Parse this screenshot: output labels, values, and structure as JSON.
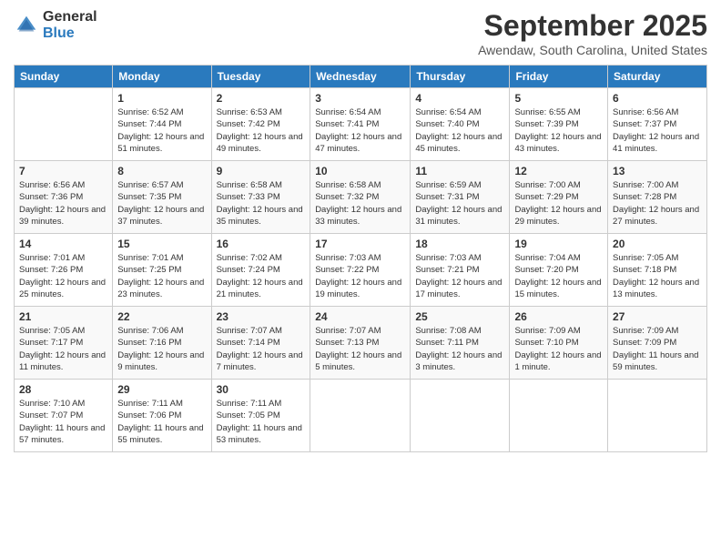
{
  "logo": {
    "line1": "General",
    "line2": "Blue"
  },
  "title": "September 2025",
  "subtitle": "Awendaw, South Carolina, United States",
  "header_days": [
    "Sunday",
    "Monday",
    "Tuesday",
    "Wednesday",
    "Thursday",
    "Friday",
    "Saturday"
  ],
  "weeks": [
    [
      {
        "day": "",
        "sunrise": "",
        "sunset": "",
        "daylight": ""
      },
      {
        "day": "1",
        "sunrise": "Sunrise: 6:52 AM",
        "sunset": "Sunset: 7:44 PM",
        "daylight": "Daylight: 12 hours and 51 minutes."
      },
      {
        "day": "2",
        "sunrise": "Sunrise: 6:53 AM",
        "sunset": "Sunset: 7:42 PM",
        "daylight": "Daylight: 12 hours and 49 minutes."
      },
      {
        "day": "3",
        "sunrise": "Sunrise: 6:54 AM",
        "sunset": "Sunset: 7:41 PM",
        "daylight": "Daylight: 12 hours and 47 minutes."
      },
      {
        "day": "4",
        "sunrise": "Sunrise: 6:54 AM",
        "sunset": "Sunset: 7:40 PM",
        "daylight": "Daylight: 12 hours and 45 minutes."
      },
      {
        "day": "5",
        "sunrise": "Sunrise: 6:55 AM",
        "sunset": "Sunset: 7:39 PM",
        "daylight": "Daylight: 12 hours and 43 minutes."
      },
      {
        "day": "6",
        "sunrise": "Sunrise: 6:56 AM",
        "sunset": "Sunset: 7:37 PM",
        "daylight": "Daylight: 12 hours and 41 minutes."
      }
    ],
    [
      {
        "day": "7",
        "sunrise": "Sunrise: 6:56 AM",
        "sunset": "Sunset: 7:36 PM",
        "daylight": "Daylight: 12 hours and 39 minutes."
      },
      {
        "day": "8",
        "sunrise": "Sunrise: 6:57 AM",
        "sunset": "Sunset: 7:35 PM",
        "daylight": "Daylight: 12 hours and 37 minutes."
      },
      {
        "day": "9",
        "sunrise": "Sunrise: 6:58 AM",
        "sunset": "Sunset: 7:33 PM",
        "daylight": "Daylight: 12 hours and 35 minutes."
      },
      {
        "day": "10",
        "sunrise": "Sunrise: 6:58 AM",
        "sunset": "Sunset: 7:32 PM",
        "daylight": "Daylight: 12 hours and 33 minutes."
      },
      {
        "day": "11",
        "sunrise": "Sunrise: 6:59 AM",
        "sunset": "Sunset: 7:31 PM",
        "daylight": "Daylight: 12 hours and 31 minutes."
      },
      {
        "day": "12",
        "sunrise": "Sunrise: 7:00 AM",
        "sunset": "Sunset: 7:29 PM",
        "daylight": "Daylight: 12 hours and 29 minutes."
      },
      {
        "day": "13",
        "sunrise": "Sunrise: 7:00 AM",
        "sunset": "Sunset: 7:28 PM",
        "daylight": "Daylight: 12 hours and 27 minutes."
      }
    ],
    [
      {
        "day": "14",
        "sunrise": "Sunrise: 7:01 AM",
        "sunset": "Sunset: 7:26 PM",
        "daylight": "Daylight: 12 hours and 25 minutes."
      },
      {
        "day": "15",
        "sunrise": "Sunrise: 7:01 AM",
        "sunset": "Sunset: 7:25 PM",
        "daylight": "Daylight: 12 hours and 23 minutes."
      },
      {
        "day": "16",
        "sunrise": "Sunrise: 7:02 AM",
        "sunset": "Sunset: 7:24 PM",
        "daylight": "Daylight: 12 hours and 21 minutes."
      },
      {
        "day": "17",
        "sunrise": "Sunrise: 7:03 AM",
        "sunset": "Sunset: 7:22 PM",
        "daylight": "Daylight: 12 hours and 19 minutes."
      },
      {
        "day": "18",
        "sunrise": "Sunrise: 7:03 AM",
        "sunset": "Sunset: 7:21 PM",
        "daylight": "Daylight: 12 hours and 17 minutes."
      },
      {
        "day": "19",
        "sunrise": "Sunrise: 7:04 AM",
        "sunset": "Sunset: 7:20 PM",
        "daylight": "Daylight: 12 hours and 15 minutes."
      },
      {
        "day": "20",
        "sunrise": "Sunrise: 7:05 AM",
        "sunset": "Sunset: 7:18 PM",
        "daylight": "Daylight: 12 hours and 13 minutes."
      }
    ],
    [
      {
        "day": "21",
        "sunrise": "Sunrise: 7:05 AM",
        "sunset": "Sunset: 7:17 PM",
        "daylight": "Daylight: 12 hours and 11 minutes."
      },
      {
        "day": "22",
        "sunrise": "Sunrise: 7:06 AM",
        "sunset": "Sunset: 7:16 PM",
        "daylight": "Daylight: 12 hours and 9 minutes."
      },
      {
        "day": "23",
        "sunrise": "Sunrise: 7:07 AM",
        "sunset": "Sunset: 7:14 PM",
        "daylight": "Daylight: 12 hours and 7 minutes."
      },
      {
        "day": "24",
        "sunrise": "Sunrise: 7:07 AM",
        "sunset": "Sunset: 7:13 PM",
        "daylight": "Daylight: 12 hours and 5 minutes."
      },
      {
        "day": "25",
        "sunrise": "Sunrise: 7:08 AM",
        "sunset": "Sunset: 7:11 PM",
        "daylight": "Daylight: 12 hours and 3 minutes."
      },
      {
        "day": "26",
        "sunrise": "Sunrise: 7:09 AM",
        "sunset": "Sunset: 7:10 PM",
        "daylight": "Daylight: 12 hours and 1 minute."
      },
      {
        "day": "27",
        "sunrise": "Sunrise: 7:09 AM",
        "sunset": "Sunset: 7:09 PM",
        "daylight": "Daylight: 11 hours and 59 minutes."
      }
    ],
    [
      {
        "day": "28",
        "sunrise": "Sunrise: 7:10 AM",
        "sunset": "Sunset: 7:07 PM",
        "daylight": "Daylight: 11 hours and 57 minutes."
      },
      {
        "day": "29",
        "sunrise": "Sunrise: 7:11 AM",
        "sunset": "Sunset: 7:06 PM",
        "daylight": "Daylight: 11 hours and 55 minutes."
      },
      {
        "day": "30",
        "sunrise": "Sunrise: 7:11 AM",
        "sunset": "Sunset: 7:05 PM",
        "daylight": "Daylight: 11 hours and 53 minutes."
      },
      {
        "day": "",
        "sunrise": "",
        "sunset": "",
        "daylight": ""
      },
      {
        "day": "",
        "sunrise": "",
        "sunset": "",
        "daylight": ""
      },
      {
        "day": "",
        "sunrise": "",
        "sunset": "",
        "daylight": ""
      },
      {
        "day": "",
        "sunrise": "",
        "sunset": "",
        "daylight": ""
      }
    ]
  ]
}
